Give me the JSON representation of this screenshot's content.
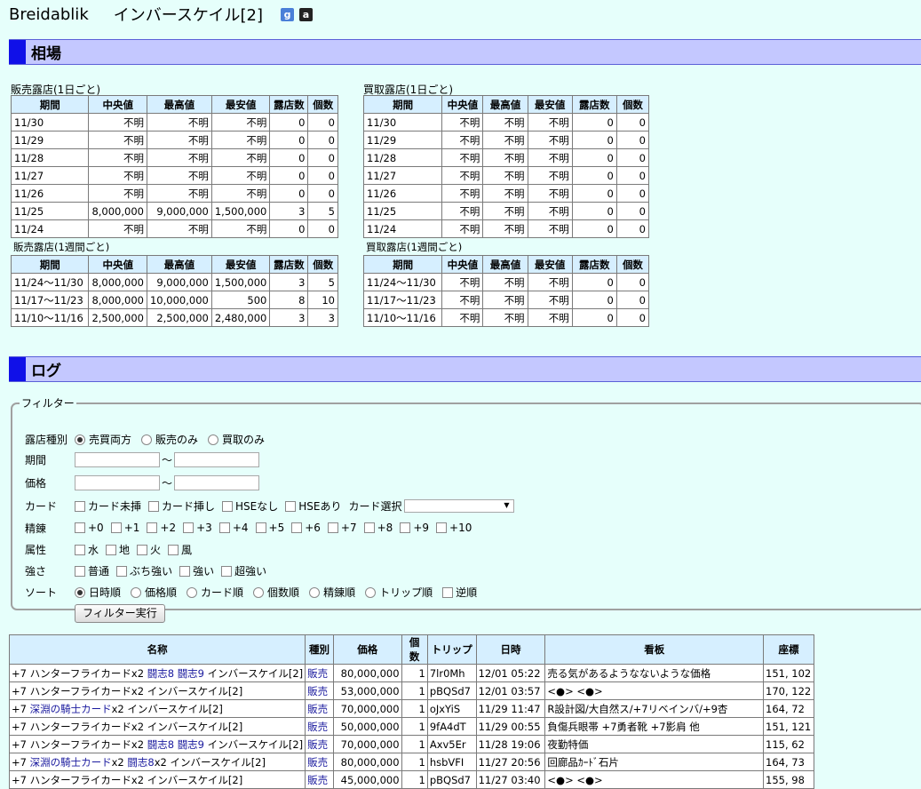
{
  "header": {
    "site": "Breidablik",
    "title": "インバースケイル[2]",
    "google_icon": "g",
    "amazon_icon": "a"
  },
  "market": {
    "heading": "相場",
    "columns": [
      "期間",
      "中央値",
      "最高値",
      "最安値",
      "露店数",
      "個数"
    ],
    "sell_daily": {
      "caption": "販売露店(1日ごと)",
      "rows": [
        [
          "11/30",
          "不明",
          "不明",
          "不明",
          "0",
          "0"
        ],
        [
          "11/29",
          "不明",
          "不明",
          "不明",
          "0",
          "0"
        ],
        [
          "11/28",
          "不明",
          "不明",
          "不明",
          "0",
          "0"
        ],
        [
          "11/27",
          "不明",
          "不明",
          "不明",
          "0",
          "0"
        ],
        [
          "11/26",
          "不明",
          "不明",
          "不明",
          "0",
          "0"
        ],
        [
          "11/25",
          "8,000,000",
          "9,000,000",
          "1,500,000",
          "3",
          "5"
        ],
        [
          "11/24",
          "不明",
          "不明",
          "不明",
          "0",
          "0"
        ]
      ]
    },
    "sell_weekly": {
      "caption": "販売露店(1週間ごと)",
      "rows": [
        [
          "11/24〜11/30",
          "8,000,000",
          "9,000,000",
          "1,500,000",
          "3",
          "5"
        ],
        [
          "11/17〜11/23",
          "8,000,000",
          "10,000,000",
          "500",
          "8",
          "10"
        ],
        [
          "11/10〜11/16",
          "2,500,000",
          "2,500,000",
          "2,480,000",
          "3",
          "3"
        ]
      ]
    },
    "buy_daily": {
      "caption": "買取露店(1日ごと)",
      "rows": [
        [
          "11/30",
          "不明",
          "不明",
          "不明",
          "0",
          "0"
        ],
        [
          "11/29",
          "不明",
          "不明",
          "不明",
          "0",
          "0"
        ],
        [
          "11/28",
          "不明",
          "不明",
          "不明",
          "0",
          "0"
        ],
        [
          "11/27",
          "不明",
          "不明",
          "不明",
          "0",
          "0"
        ],
        [
          "11/26",
          "不明",
          "不明",
          "不明",
          "0",
          "0"
        ],
        [
          "11/25",
          "不明",
          "不明",
          "不明",
          "0",
          "0"
        ],
        [
          "11/24",
          "不明",
          "不明",
          "不明",
          "0",
          "0"
        ]
      ]
    },
    "buy_weekly": {
      "caption": "買取露店(1週間ごと)",
      "rows": [
        [
          "11/24〜11/30",
          "不明",
          "不明",
          "不明",
          "0",
          "0"
        ],
        [
          "11/17〜11/23",
          "不明",
          "不明",
          "不明",
          "0",
          "0"
        ],
        [
          "11/10〜11/16",
          "不明",
          "不明",
          "不明",
          "0",
          "0"
        ]
      ]
    }
  },
  "log": {
    "heading": "ログ",
    "filter": {
      "legend": "フィルター",
      "shop_type": {
        "label": "露店種別",
        "options": [
          "売買両方",
          "販売のみ",
          "買取のみ"
        ],
        "selected": 0
      },
      "period": {
        "label": "期間",
        "tilde": "〜"
      },
      "price": {
        "label": "価格",
        "tilde": "〜"
      },
      "card": {
        "label": "カード",
        "options": [
          "カード未挿",
          "カード挿し",
          "HSEなし",
          "HSEあり"
        ],
        "select_label": "カード選択"
      },
      "refine": {
        "label": "精錬",
        "options": [
          "+0",
          "+1",
          "+2",
          "+3",
          "+4",
          "+5",
          "+6",
          "+7",
          "+8",
          "+9",
          "+10"
        ]
      },
      "element": {
        "label": "属性",
        "options": [
          "水",
          "地",
          "火",
          "風"
        ]
      },
      "strength": {
        "label": "強さ",
        "options": [
          "普通",
          "ぶち強い",
          "強い",
          "超強い"
        ]
      },
      "sort": {
        "label": "ソート",
        "options": [
          "日時順",
          "価格順",
          "カード順",
          "個数順",
          "精錬順",
          "トリップ順"
        ],
        "selected": 0,
        "reverse_label": "逆順"
      },
      "submit_label": "フィルター実行"
    },
    "columns": [
      "名称",
      "種別",
      "価格",
      "個数",
      "トリップ",
      "日時",
      "看板",
      "座標"
    ],
    "rows": [
      {
        "name_parts": [
          "+7 ハンターフライカードx2 ",
          "闘志8",
          " ",
          "闘志9",
          " インバースケイル[2]"
        ],
        "type": "販売",
        "price": "80,000,000",
        "count": "1",
        "trip": "7lr0Mh",
        "date": "12/01 05:22",
        "sign": "売る気があるようなないような価格",
        "coord": "151, 102"
      },
      {
        "name_parts": [
          "+7 ハンターフライカードx2 インバースケイル[2]"
        ],
        "type": "販売",
        "price": "53,000,000",
        "count": "1",
        "trip": "pBQSd7",
        "date": "12/01 03:57",
        "sign": "<●> <●>",
        "coord": "170, 122"
      },
      {
        "name_parts": [
          "+7 ",
          "深淵の騎士カード",
          "x2 インバースケイル[2]"
        ],
        "type": "販売",
        "price": "70,000,000",
        "count": "1",
        "trip": "oJxYiS",
        "date": "11/29 11:47",
        "sign": "R設計図/大自然ス/+7リベインバ/+9杏",
        "coord": "164, 72"
      },
      {
        "name_parts": [
          "+7 ハンターフライカードx2 インバースケイル[2]"
        ],
        "type": "販売",
        "price": "50,000,000",
        "count": "1",
        "trip": "9fA4dT",
        "date": "11/29 00:55",
        "sign": "負傷兵眼帯 +7勇者靴 +7影肩 他",
        "coord": "151, 121"
      },
      {
        "name_parts": [
          "+7 ハンターフライカードx2 ",
          "闘志8",
          " ",
          "闘志9",
          " インバースケイル[2]"
        ],
        "type": "販売",
        "price": "70,000,000",
        "count": "1",
        "trip": "Axv5Er",
        "date": "11/28 19:06",
        "sign": "夜勤特価",
        "coord": "115, 62"
      },
      {
        "name_parts": [
          "+7 ",
          "深淵の騎士カード",
          "x2 ",
          "闘志8",
          "x2 インバースケイル[2]"
        ],
        "type": "販売",
        "price": "80,000,000",
        "count": "1",
        "trip": "hsbVFI",
        "date": "11/27 20:56",
        "sign": "回廊品ｶｰﾄﾞ石片",
        "coord": "164, 73"
      },
      {
        "name_parts": [
          "+7 ハンターフライカードx2 インバースケイル[2]"
        ],
        "type": "販売",
        "price": "45,000,000",
        "count": "1",
        "trip": "pBQSd7",
        "date": "11/27 03:40",
        "sign": "<●> <●>",
        "coord": "155, 98"
      }
    ]
  }
}
